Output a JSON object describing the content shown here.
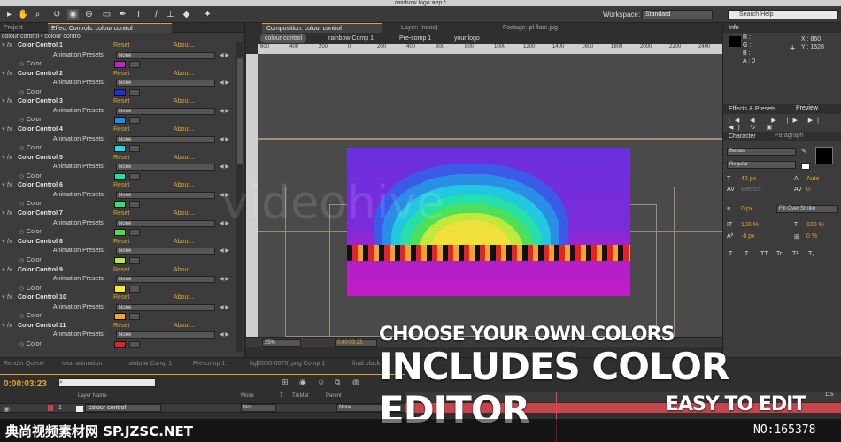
{
  "window": {
    "title": "rainbow logo.aep *"
  },
  "toolbar": {
    "workspace_label": "Workspace:",
    "workspace_value": "Standard",
    "search_placeholder": "Search Help"
  },
  "left_panel": {
    "tabs": [
      "Project",
      "Effect Controls: colour control"
    ],
    "breadcrumb": "colour control • colour control",
    "reset_label": "Reset",
    "about_label": "About...",
    "presets_label": "Animation Presets:",
    "presets_value": "None",
    "color_label": "Color",
    "effects": [
      {
        "name": "Color Control 1",
        "color": "#c21fd0"
      },
      {
        "name": "Color Control 2",
        "color": "#1e2ee0"
      },
      {
        "name": "Color Control 3",
        "color": "#1f8ee8"
      },
      {
        "name": "Color Control 4",
        "color": "#1fd8e8"
      },
      {
        "name": "Color Control 5",
        "color": "#22e0a0"
      },
      {
        "name": "Color Control 6",
        "color": "#2ee07a"
      },
      {
        "name": "Color Control 7",
        "color": "#45e04a"
      },
      {
        "name": "Color Control 8",
        "color": "#bde83a"
      },
      {
        "name": "Color Control 9",
        "color": "#f2e83a"
      },
      {
        "name": "Color Control 10",
        "color": "#f2a52a"
      },
      {
        "name": "Color Control 11",
        "color": "#e8202a"
      }
    ]
  },
  "comp": {
    "tabs": [
      "Composition: colour control",
      "Layer: (none)",
      "Footage: pl flare.jpg"
    ],
    "subtabs": [
      "colour control",
      "rainbow Comp 1",
      "Pre-comp 1",
      "your logo"
    ],
    "ruler_ticks": [
      "600",
      "400",
      "200",
      "0",
      "200",
      "400",
      "600",
      "800",
      "1000",
      "1200",
      "1400",
      "1600",
      "1800",
      "2000",
      "2200",
      "2400"
    ],
    "zoom": "25%",
    "timecode": "0:00:03:23"
  },
  "info": {
    "title": "Info",
    "r": "R :",
    "g": "G :",
    "b": "B :",
    "a": "A : 0",
    "x": "X : 860",
    "y": "Y : 1528"
  },
  "right_tabs": {
    "effects": "Effects & Presets",
    "preview": "Preview",
    "character": "Character",
    "paragraph": "Paragraph"
  },
  "character": {
    "font": "Bebas",
    "style": "Regular",
    "size": "42 px",
    "leading": "Auto",
    "kerning": "Metrics",
    "tracking": "0",
    "stroke_width": "0 px",
    "stroke_mode": "Fill Over Stroke",
    "vscale": "100 %",
    "hscale": "100 %",
    "baseline": "-8 px",
    "tsume": "0 %",
    "format_buttons": [
      "T",
      "T",
      "TT",
      "Tr",
      "T¹",
      "T₁"
    ]
  },
  "timeline": {
    "tabs": [
      "Render Queue",
      "total animation",
      "rainbow Comp 1",
      "Pre-comp 1",
      "bg[0000-0075].png Comp 1",
      "final black"
    ],
    "timecode": "0:00:03:23",
    "columns": {
      "layer_name": "Layer Name",
      "mode": "Mode",
      "t": "T",
      "trkmat": "TrkMat",
      "parent": "Parent"
    },
    "layer": {
      "index": "1",
      "name": "colour control",
      "mode": "Nor...",
      "parent": "None"
    },
    "end_marker": "115"
  },
  "overlay": {
    "line1": "CHOOSE YOUR OWN COLORS",
    "line2": "INCLUDES COLOR EDITOR",
    "line3": "EASY TO EDIT"
  },
  "watermark": {
    "left": "典尚视频素材网 SP.JZSC.NET",
    "right": "NO:165378",
    "faint": "videohive"
  }
}
